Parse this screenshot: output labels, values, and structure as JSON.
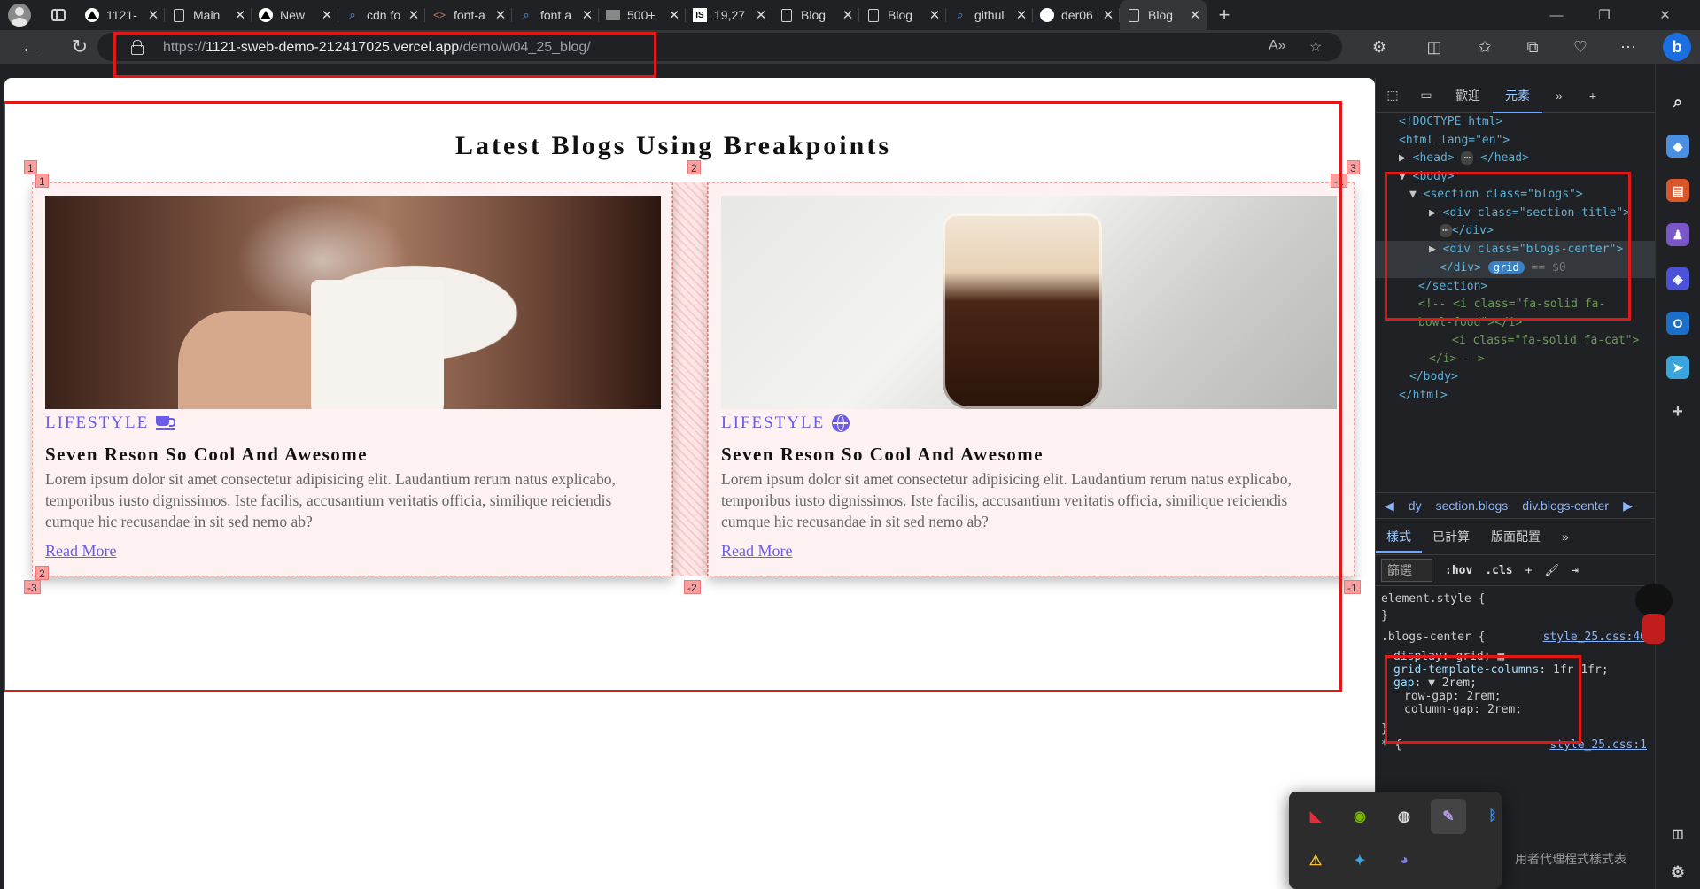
{
  "tabs": [
    {
      "label": "1121-",
      "icon": "vercel-icon"
    },
    {
      "label": "Main",
      "icon": "page-icon"
    },
    {
      "label": "New",
      "icon": "vercel-icon"
    },
    {
      "label": "cdn fo",
      "icon": "search-icon"
    },
    {
      "label": "font-a",
      "icon": "code-icon"
    },
    {
      "label": "font a",
      "icon": "search-icon"
    },
    {
      "label": "500+",
      "icon": "image-icon"
    },
    {
      "label": "19,27",
      "icon": "is-icon"
    },
    {
      "label": "Blog",
      "icon": "page-icon"
    },
    {
      "label": "Blog",
      "icon": "page-icon"
    },
    {
      "label": "githul",
      "icon": "search-icon"
    },
    {
      "label": "der06",
      "icon": "github-icon"
    },
    {
      "label": "Blog",
      "icon": "page-icon",
      "active": true
    }
  ],
  "address": {
    "scheme": "https://",
    "host": "1121-sweb-demo-212417025.vercel.app",
    "path": "/demo/w04_25_blog/"
  },
  "page": {
    "title": "Latest Blogs Using Breakpoints",
    "cards": [
      {
        "category": "LIFESTYLE",
        "category_icon": "mug-saucer-icon",
        "title": "Seven Reson So Cool And Awesome",
        "body": "Lorem ipsum dolor sit amet consectetur adipisicing elit. Laudantium rerum natus explicabo, temporibus iusto dignissimos. Iste facilis, accusantium veritatis officia, similique reiciendis cumque hic recusandae in sit sed nemo ab?",
        "link": "Read More"
      },
      {
        "category": "LIFESTYLE",
        "category_icon": "globe-icon",
        "title": "Seven Reson So Cool And Awesome",
        "body": "Lorem ipsum dolor sit amet consectetur adipisicing elit. Laudantium rerum natus explicabo, temporibus iusto dignissimos. Iste facilis, accusantium veritatis officia, similique reiciendis cumque hic recusandae in sit sed nemo ab?",
        "link": "Read More"
      }
    ],
    "grid_labels": {
      "top_left_outer": "1",
      "top_left_inner": "1",
      "top_mid": "2",
      "top_right": "3",
      "top_right_inner": "-1",
      "bottom_left": "-3",
      "bottom_left_inner": "2",
      "bottom_mid": "-2",
      "bottom_right": "-1"
    }
  },
  "devtools": {
    "tabs": [
      "歡迎",
      "元素"
    ],
    "active_tab": "元素",
    "dom": [
      "<!DOCTYPE html>",
      "<html lang=\"en\">",
      "<head>",
      "</head>",
      "<body>",
      "<section class=\"blogs\">",
      "<div class=\"section-title\">",
      "</div>",
      "<div class=\"blogs-center\">",
      "</div>",
      "grid",
      "== $0",
      "</section>",
      "<!-- <i class=\"fa-solid fa-",
      "bowl-food\"></i>",
      "<i class=\"fa-solid fa-cat\">",
      "</i> -->",
      "</body>",
      "</html>"
    ],
    "breadcrumb": [
      "dy",
      "section.blogs",
      "div.blogs-center"
    ],
    "styles_tabs": [
      "樣式",
      "已計算",
      "版面配置"
    ],
    "filter_placeholder": "篩選",
    "filter_buttons": [
      ":hov",
      ".cls"
    ],
    "rules": {
      "element_style": "element.style {",
      "close": "}",
      "selector": ".blogs-center {",
      "source": "style_25.css:40",
      "decls": [
        {
          "prop": "display",
          "value": "grid;"
        },
        {
          "prop": "grid-template-columns",
          "value": "1fr 1fr;"
        },
        {
          "prop": "gap",
          "value": "2rem;"
        },
        {
          "prop": "row-gap",
          "value": "2rem;"
        },
        {
          "prop": "column-gap",
          "value": "2rem;"
        }
      ],
      "next_selector": "* {",
      "next_source": "style_25.css:1"
    }
  },
  "tray": {
    "hint": "用者代理程式樣式表"
  }
}
